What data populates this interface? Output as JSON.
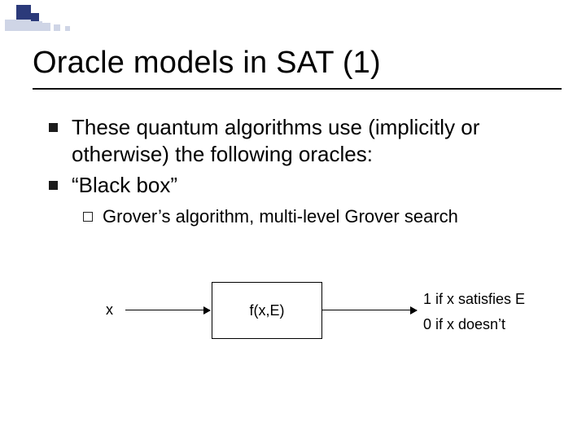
{
  "title": "Oracle models in SAT (1)",
  "bullets": {
    "b1": "These quantum algorithms use (implicitly or otherwise) the following oracles:",
    "b2": "“Black box”",
    "b2_sub1": "Grover’s algorithm, multi-level Grover search"
  },
  "diagram": {
    "input": "x",
    "box": "f(x,E)",
    "out1": "1 if x satisfies E",
    "out2": "0 if x doesn’t"
  }
}
